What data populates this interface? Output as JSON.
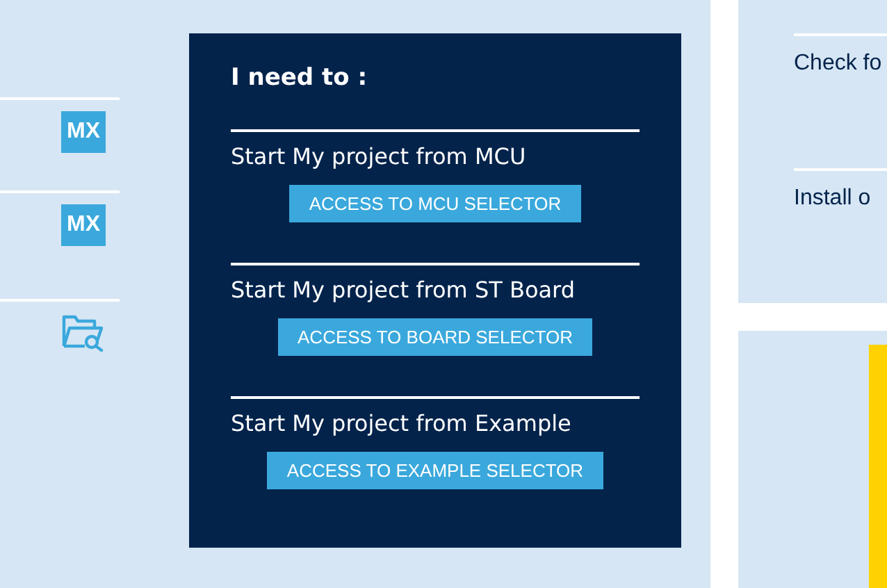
{
  "shortcuts": [
    {
      "kind": "mx",
      "badge": "MX"
    },
    {
      "kind": "mx",
      "badge": "MX"
    },
    {
      "kind": "folder-search"
    }
  ],
  "panel": {
    "title": "I need to :",
    "options": [
      {
        "label": "Start My project from MCU",
        "button": "ACCESS TO MCU SELECTOR"
      },
      {
        "label": "Start My project from ST Board",
        "button": "ACCESS TO BOARD SELECTOR"
      },
      {
        "label": "Start My project from Example",
        "button": "ACCESS TO EXAMPLE SELECTOR"
      }
    ]
  },
  "side_items": [
    "Check fo",
    "Install o"
  ]
}
